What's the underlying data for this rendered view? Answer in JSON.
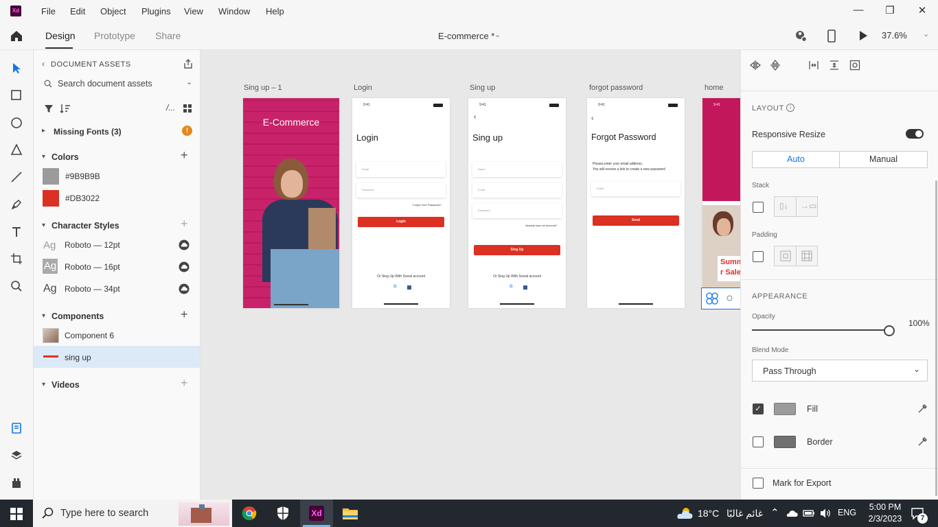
{
  "app": {
    "logo": "Xd",
    "doc_title": "E-commerce *",
    "zoom": "37.6%"
  },
  "menu": [
    "File",
    "Edit",
    "Object",
    "Plugins",
    "View",
    "Window",
    "Help"
  ],
  "modes": [
    "Design",
    "Prototype",
    "Share"
  ],
  "assets": {
    "back_label": "DOCUMENT ASSETS",
    "search_placeholder": "Search document assets",
    "missing_fonts": "Missing Fonts (3)",
    "colors_title": "Colors",
    "colors": [
      {
        "hex": "#9B9B9B",
        "label": "#9B9B9B"
      },
      {
        "hex": "#DB3022",
        "label": "#DB3022"
      }
    ],
    "char_title": "Character Styles",
    "char_styles": [
      {
        "sample": "Ag",
        "label": "Roboto — 12pt"
      },
      {
        "sample": "Ag",
        "label": "Roboto — 16pt"
      },
      {
        "sample": "Ag",
        "label": "Roboto — 34pt"
      }
    ],
    "components_title": "Components",
    "components": [
      "Component 6",
      "sing up"
    ],
    "videos_title": "Videos"
  },
  "artboards": [
    {
      "label": "Sing up – 1",
      "hero": "E-Commerce"
    },
    {
      "label": "Login",
      "time": "9:41",
      "title": "Login",
      "fields": [
        "Email",
        "Password"
      ],
      "link": "Forgot Your Password?",
      "button": "Login",
      "social": "Or Sing Up With Social account"
    },
    {
      "label": "Sing up",
      "time": "9:41",
      "title": "Sing up",
      "fields": [
        "Name",
        "Email",
        "Password"
      ],
      "link": "Already have an account?",
      "button": "Sing Up",
      "social": "Or Sing Up With Social account"
    },
    {
      "label": "forgot password",
      "time": "9:41",
      "title": "Forgot Password",
      "desc1": "Please,enter your email address.",
      "desc2": "You will receive a link to create a new password",
      "fields": [
        "Email"
      ],
      "button": "Send"
    },
    {
      "label": "home",
      "time": "9:41",
      "banner1": "Summ",
      "banner2": "r Sale"
    }
  ],
  "props": {
    "layout": "LAYOUT",
    "responsive": "Responsive Resize",
    "responsive_on": true,
    "auto": "Auto",
    "manual": "Manual",
    "stack": "Stack",
    "padding": "Padding",
    "appearance": "APPEARANCE",
    "opacity_label": "Opacity",
    "opacity_value": "100%",
    "opacity_fraction": 1.0,
    "blend_label": "Blend Mode",
    "blend_value": "Pass Through",
    "fill_label": "Fill",
    "fill_checked": true,
    "fill_color": "#9B9B9B",
    "border_label": "Border",
    "border_color": "#707070",
    "export_label": "Mark for Export"
  },
  "taskbar": {
    "search_placeholder": "Type here to search",
    "weather_temp": "18°C",
    "weather_text": "غائم غالبًا",
    "lang": "ENG",
    "time": "5:00 PM",
    "date": "2/3/2023",
    "notif_count": "7"
  },
  "colors": {
    "accent": "#DB3022",
    "brand_xd": "#470137",
    "xd_pink": "#FF61F6",
    "selection": "#1473E6",
    "hero_pink": "#C2185B"
  }
}
